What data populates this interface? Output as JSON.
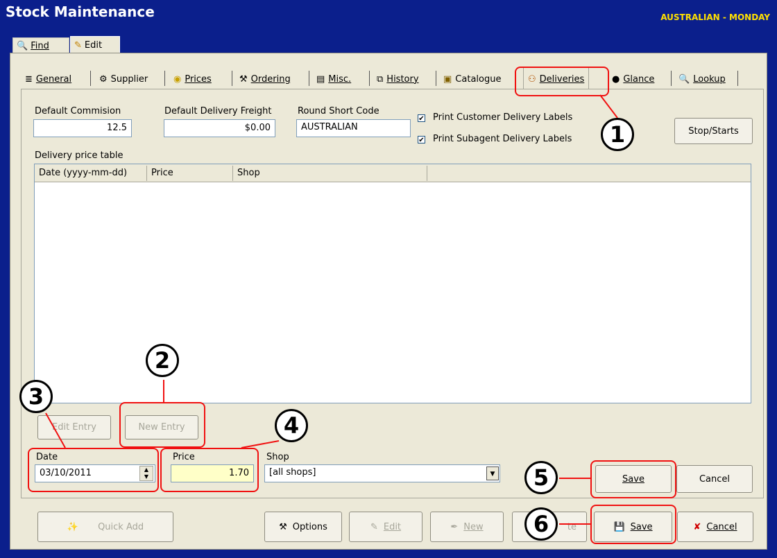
{
  "window": {
    "title": "Stock Maintenance",
    "context": "AUSTRALIAN - MONDAY"
  },
  "top_tabs": [
    {
      "label": "Find"
    },
    {
      "label": "Edit"
    }
  ],
  "tabs": [
    {
      "label": "General"
    },
    {
      "label": "Supplier"
    },
    {
      "label": "Prices"
    },
    {
      "label": "Ordering"
    },
    {
      "label": "Misc."
    },
    {
      "label": "History"
    },
    {
      "label": "Catalogue"
    },
    {
      "label": "Deliveries"
    },
    {
      "label": "Glance"
    },
    {
      "label": "Lookup"
    }
  ],
  "form": {
    "default_commission_label": "Default  Commision",
    "default_commission_value": "12.5",
    "default_freight_label": "Default Delivery Freight",
    "default_freight_value": "$0.00",
    "round_code_label": "Round Short Code",
    "round_code_value": "AUSTRALIAN",
    "print_customer_label": "Print Customer Delivery Labels",
    "print_subagent_label": "Print Subagent Delivery Labels",
    "stop_starts_label": "Stop/Starts",
    "checkbox_mark": "✔"
  },
  "table": {
    "caption": "Delivery price table",
    "columns": [
      "Date (yyyy-mm-dd)",
      "Price",
      "Shop"
    ]
  },
  "entry": {
    "edit_entry_label": "Edit Entry",
    "new_entry_label": "New Entry",
    "date_label": "Date",
    "date_value": "03/10/2011",
    "price_label": "Price",
    "price_value": "1.70",
    "shop_label": "Shop",
    "shop_value": "[all shops]",
    "save_label": "Save",
    "cancel_label": "Cancel"
  },
  "bottom": {
    "quick_add_label": "Quick Add",
    "options_label": "Options",
    "edit_label": "Edit",
    "new_label": "New",
    "delete_fragment": "te",
    "save_label": "Save",
    "cancel_label": "Cancel"
  },
  "callouts": [
    "1",
    "2",
    "3",
    "4",
    "5",
    "6"
  ],
  "colors": {
    "title_bar": "#0b1f8c",
    "context_text": "#ffe000",
    "callout_border": "#f01010",
    "price_field": "#ffffc8"
  }
}
